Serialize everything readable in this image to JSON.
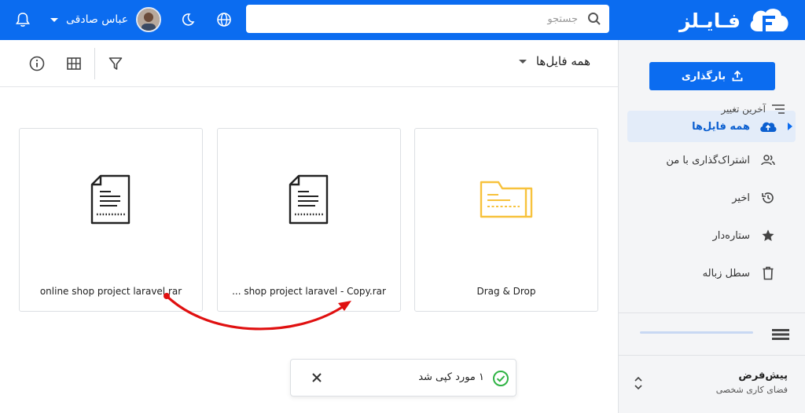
{
  "header": {
    "logo_text": "فـایـلز",
    "search_placeholder": "جستجو",
    "user_name": "عباس صادقی"
  },
  "sidebar": {
    "upload_label": "بارگذاری",
    "items": [
      {
        "label": "همه فایل‌ها",
        "icon": "cloud-upload-icon",
        "active": true
      },
      {
        "label": "اشتراک‌گذاری با من",
        "icon": "people-icon",
        "active": false
      },
      {
        "label": "اخیر",
        "icon": "history-icon",
        "active": false
      },
      {
        "label": "ستاره‌دار",
        "icon": "star-icon",
        "active": false
      },
      {
        "label": "سطل زباله",
        "icon": "trash-icon",
        "active": false
      }
    ],
    "workspace_title": "پیش‌فرض",
    "workspace_subtitle": "فضای کاری شخصی"
  },
  "main": {
    "folder_title": "همه فایل‌ها",
    "sort_label": "آخرین تغییر",
    "cards": [
      {
        "name": "Drag & Drop",
        "type": "folder"
      },
      {
        "name": "shop project laravel - Copy.rar ...",
        "type": "file"
      },
      {
        "name": "online shop project laravel.rar",
        "type": "file"
      }
    ]
  },
  "toast": {
    "message": "۱ مورد کپی شد"
  },
  "colors": {
    "primary": "#0b6cf0",
    "folder": "#f7c23c",
    "annotation_arrow": "#e01010",
    "success": "#2fb344"
  }
}
